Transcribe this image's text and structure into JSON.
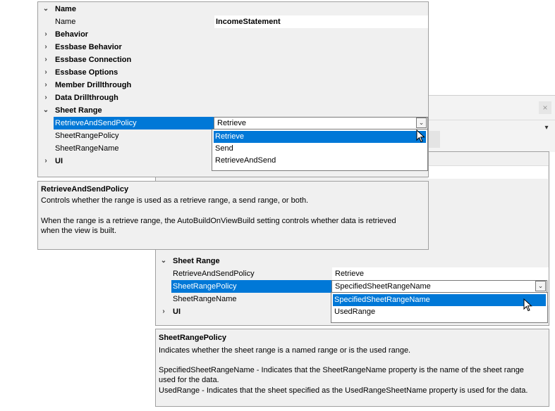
{
  "top": {
    "categories": [
      {
        "label": "Name",
        "expanded": true
      },
      {
        "label": "Behavior",
        "expanded": false
      },
      {
        "label": "Essbase Behavior",
        "expanded": false
      },
      {
        "label": "Essbase Connection",
        "expanded": false
      },
      {
        "label": "Essbase Options",
        "expanded": false
      },
      {
        "label": "Member Drillthrough",
        "expanded": false
      },
      {
        "label": "Data Drillthrough",
        "expanded": false
      },
      {
        "label": "Sheet Range",
        "expanded": true
      },
      {
        "label": "UI",
        "expanded": false
      }
    ],
    "name_prop": {
      "label": "Name",
      "value": "IncomeStatement"
    },
    "sheet_props": [
      {
        "label": "RetrieveAndSendPolicy",
        "value": "Retrieve"
      },
      {
        "label": "SheetRangePolicy",
        "value": ""
      },
      {
        "label": "SheetRangeName",
        "value": ""
      }
    ],
    "dropdown_options": [
      "Retrieve",
      "Send",
      "RetrieveAndSend"
    ],
    "dropdown_selected": "Retrieve",
    "help": {
      "title": "RetrieveAndSendPolicy",
      "line1": "Controls whether the range is used as a retrieve range, a send range, or both.",
      "line2": "When the range is a retrieve range, the AutoBuildOnViewBuild setting controls whether data is retrieved",
      "line3": "when the view is built."
    }
  },
  "bottom": {
    "categories": [
      {
        "label": "Sheet Range",
        "expanded": true
      },
      {
        "label": "UI",
        "expanded": false
      }
    ],
    "sheet_props": [
      {
        "label": "RetrieveAndSendPolicy",
        "value": "Retrieve"
      },
      {
        "label": "SheetRangePolicy",
        "value": "SpecifiedSheetRangeName"
      },
      {
        "label": "SheetRangeName",
        "value": ""
      }
    ],
    "dropdown_options": [
      "SpecifiedSheetRangeName",
      "UsedRange"
    ],
    "dropdown_selected": "SpecifiedSheetRangeName",
    "help": {
      "title": "SheetRangePolicy",
      "line1": "Indicates whether the sheet range is a named range or is the used range.",
      "line2": "SpecifiedSheetRangeName - Indicates that the SheetRangeName property is the name of the sheet range",
      "line3": "used for the data.",
      "line4": "UsedRange - Indicates that the sheet specified as the UsedRangeSheetName property is used for the data."
    }
  },
  "background_window": {
    "close_glyph": "×",
    "menu_glyph": "≡"
  },
  "icons": {
    "expanded": "⌄",
    "collapsed": "›",
    "dropdown": "⌄"
  },
  "colors": {
    "selection": "#0078d7",
    "panel": "#f0f0f0",
    "border": "#a0a0a0"
  }
}
